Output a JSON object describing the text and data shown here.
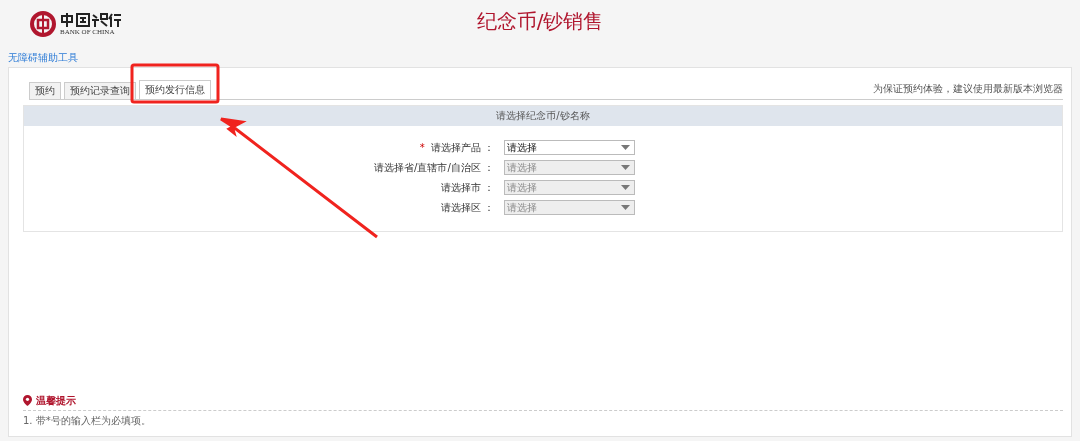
{
  "header": {
    "logo_text": "BANK OF CHINA",
    "title": "纪念币/钞销售"
  },
  "accessibility_link": "无障碍辅助工具",
  "tabs": [
    {
      "label": "预约",
      "selected": false
    },
    {
      "label": "预约记录查询",
      "selected": false
    },
    {
      "label": "预约发行信息",
      "selected": true
    }
  ],
  "browser_hint": "为保证预约体验，建议使用最新版本浏览器",
  "form": {
    "title": "请选择纪念币/钞名称",
    "required_mark": "*",
    "fields": [
      {
        "label": "请选择产品 ：",
        "required": true,
        "disabled": false,
        "value": "请选择"
      },
      {
        "label": "请选择省/直辖市/自治区 ：",
        "required": false,
        "disabled": true,
        "value": "请选择"
      },
      {
        "label": "请选择市 ：",
        "required": false,
        "disabled": true,
        "value": "请选择"
      },
      {
        "label": "请选择区 ：",
        "required": false,
        "disabled": true,
        "value": "请选择"
      }
    ]
  },
  "tips": {
    "title": "温馨提示",
    "items": [
      "1. 带*号的输入栏为必填项。"
    ]
  }
}
